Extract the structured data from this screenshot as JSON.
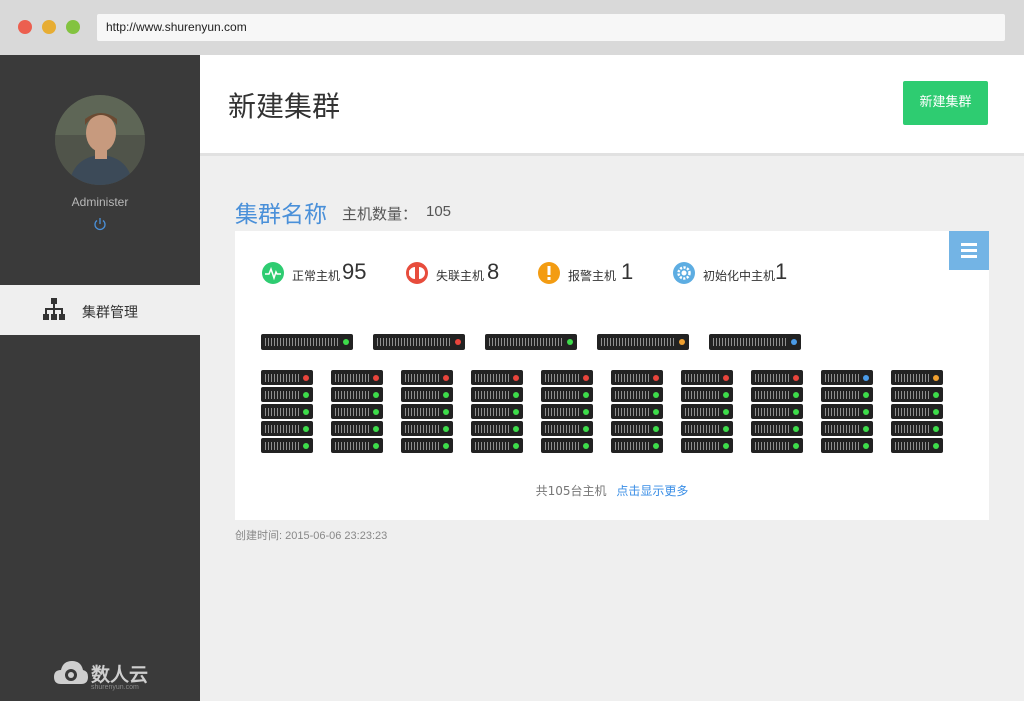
{
  "browser": {
    "url": "http://www.shurenyun.com"
  },
  "sidebar": {
    "user_name": "Administer",
    "nav_items": [
      {
        "label": "集群管理",
        "icon": "org-chart-icon",
        "active": true
      }
    ],
    "brand": {
      "name": "数人云",
      "domain": "shurenyun.com"
    }
  },
  "header": {
    "title": "新建集群",
    "new_button_label": "新建集群"
  },
  "cluster": {
    "name": "集群名称",
    "host_count_label": "主机数量：",
    "host_count_value": "105",
    "stats": [
      {
        "label": "正常主机",
        "value": "95",
        "icon": "heartbeat-icon",
        "color": "#2ecc71"
      },
      {
        "label": "失联主机",
        "value": "8",
        "icon": "disconnect-icon",
        "color": "#e74c3c"
      },
      {
        "label": "报警主机",
        "value": "1",
        "icon": "warning-icon",
        "color": "#f39c12"
      },
      {
        "label": "初始化中主机",
        "value": "1",
        "icon": "gear-icon",
        "color": "#5dade2"
      }
    ],
    "top_row_status": [
      "green",
      "red",
      "green",
      "orange",
      "blue"
    ],
    "grid_top_status": [
      "red",
      "red",
      "red",
      "red",
      "red",
      "red",
      "red",
      "red",
      "blue",
      "orange"
    ],
    "footer_total": "共105台主机",
    "footer_more": "点击显示更多",
    "created": "创建时间: 2015-06-06 23:23:23"
  },
  "colors": {
    "green": "#3ddc4a",
    "red": "#e8453c",
    "orange": "#f0a030",
    "blue": "#4a9be8",
    "accent": "#2ecc71",
    "link": "#3a8ee6"
  }
}
